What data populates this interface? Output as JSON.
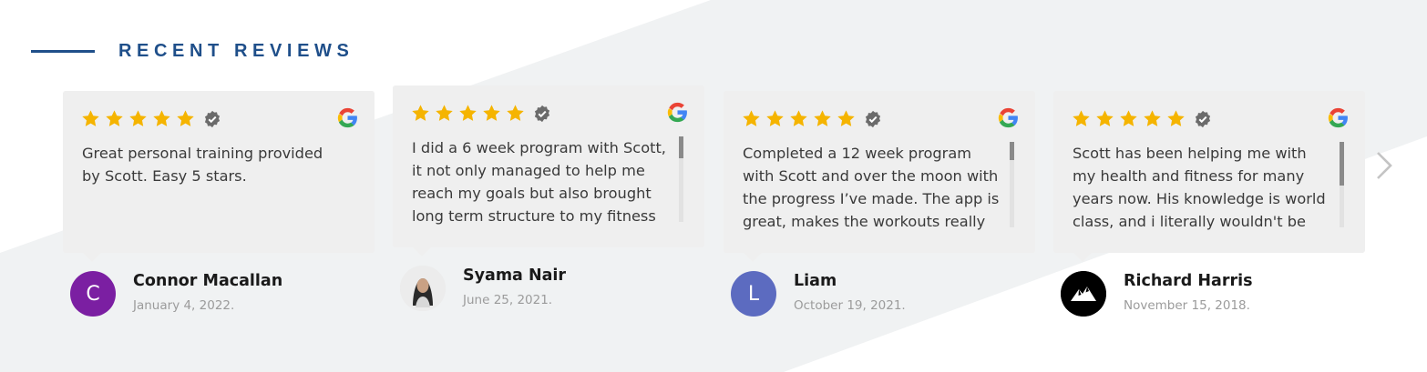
{
  "header": {
    "title": "RECENT REVIEWS"
  },
  "colors": {
    "accent": "#1f4f8a",
    "star": "#f5b400",
    "card": "#efefef"
  },
  "reviews": [
    {
      "rating": 5,
      "source": "google-icon",
      "text": "Great personal training provided by Scott. Easy 5 stars.",
      "author": "Connor Macallan",
      "date": "January 4, 2022.",
      "avatar_letter": "C",
      "avatar_color": "#7b1fa2",
      "scrollable": false
    },
    {
      "rating": 5,
      "source": "google-icon",
      "text": "I did a 6 week program with Scott, it not only managed to help me reach my goals but also brought long term structure to my fitness",
      "author": "Syama Nair",
      "date": "June 25, 2021.",
      "avatar_letter": "",
      "avatar_color": "#e8e8e8",
      "scrollable": true
    },
    {
      "rating": 5,
      "source": "google-icon",
      "text": "Completed a 12 week program with Scott and over the moon with the progress I’ve made. The app is great, makes the workouts really",
      "author": "Liam",
      "date": "October 19, 2021.",
      "avatar_letter": "L",
      "avatar_color": "#5c6bc0",
      "scrollable": true
    },
    {
      "rating": 5,
      "source": "google-icon",
      "text": "Scott has been helping me with my health and fitness for many years now. His knowledge is world class, and i literally wouldn't be",
      "author": "Richard Harris",
      "date": "November 15, 2018.",
      "avatar_letter": "",
      "avatar_color": "#000000",
      "scrollable": true
    }
  ],
  "navigation": {
    "next_icon": "chevron-right-icon"
  }
}
